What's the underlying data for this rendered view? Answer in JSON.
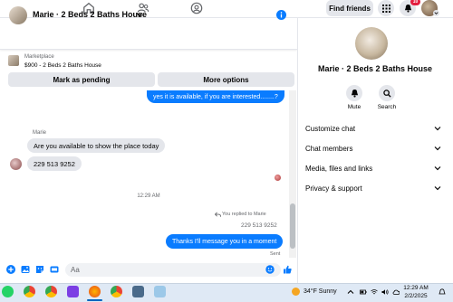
{
  "topnav": {
    "icons": [
      "home-icon",
      "friends-icon",
      "groups-icon"
    ],
    "find_friends_label": "Find friends",
    "notification_count": "10"
  },
  "chat": {
    "header_title": "Marie · 2 Beds 2 Baths House",
    "listing_label": "Marketplace",
    "listing_price_title": "$900 - 2 Beds 2 Baths House",
    "mark_pending_label": "Mark as pending",
    "more_options_label": "More options",
    "messages": {
      "out_1": "yes it is available, if you are interested........?",
      "sender_name": "Marie",
      "in_1": "Are you available to show the place today",
      "in_2": "229 513 9252",
      "timestamp": "12:29 AM",
      "replied_note": "You replied to Marie",
      "quoted": "229 513 9252",
      "out_2": "Thanks I'll message you in a moment",
      "sent_label": "Sent"
    },
    "composer_placeholder": "Aa"
  },
  "right_panel": {
    "title": "Marie · 2 Beds 2 Baths House",
    "mute_label": "Mute",
    "search_label": "Search",
    "rows": [
      "Customize chat",
      "Chat members",
      "Media, files and links",
      "Privacy & support"
    ]
  },
  "taskbar": {
    "weather_text": "34°F  Sunny",
    "time": "12:29 AM",
    "date": "2/2/2025"
  },
  "colors": {
    "accent": "#0a7cff",
    "bubble_in": "#e4e6eb",
    "notif_badge": "#e41e3f"
  }
}
